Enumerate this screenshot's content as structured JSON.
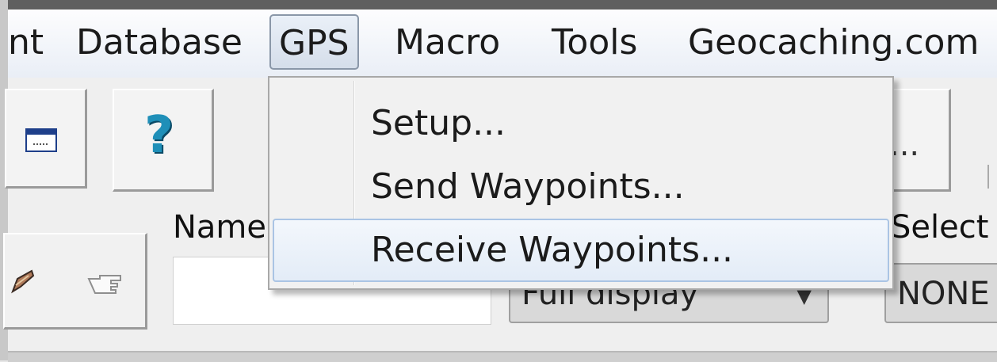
{
  "menubar": {
    "items": [
      {
        "label": "nt"
      },
      {
        "label": "Database"
      },
      {
        "label": "GPS"
      },
      {
        "label": "Macro"
      },
      {
        "label": "Tools"
      },
      {
        "label": "Geocaching.com"
      }
    ],
    "active": "GPS"
  },
  "toolbar": {
    "help_glyph": "?",
    "ellipsis_text": "...",
    "name_label": "Name",
    "select_label": "Select",
    "display_combo_value": "Full display",
    "select_combo_value": "NONE",
    "help_color": "#1f8fb8"
  },
  "gps_menu": {
    "items": [
      {
        "label": "Setup..."
      },
      {
        "label": "Send Waypoints..."
      },
      {
        "label": "Receive Waypoints..."
      }
    ],
    "highlighted_index": 2,
    "highlight_color": "#aac4e4"
  }
}
